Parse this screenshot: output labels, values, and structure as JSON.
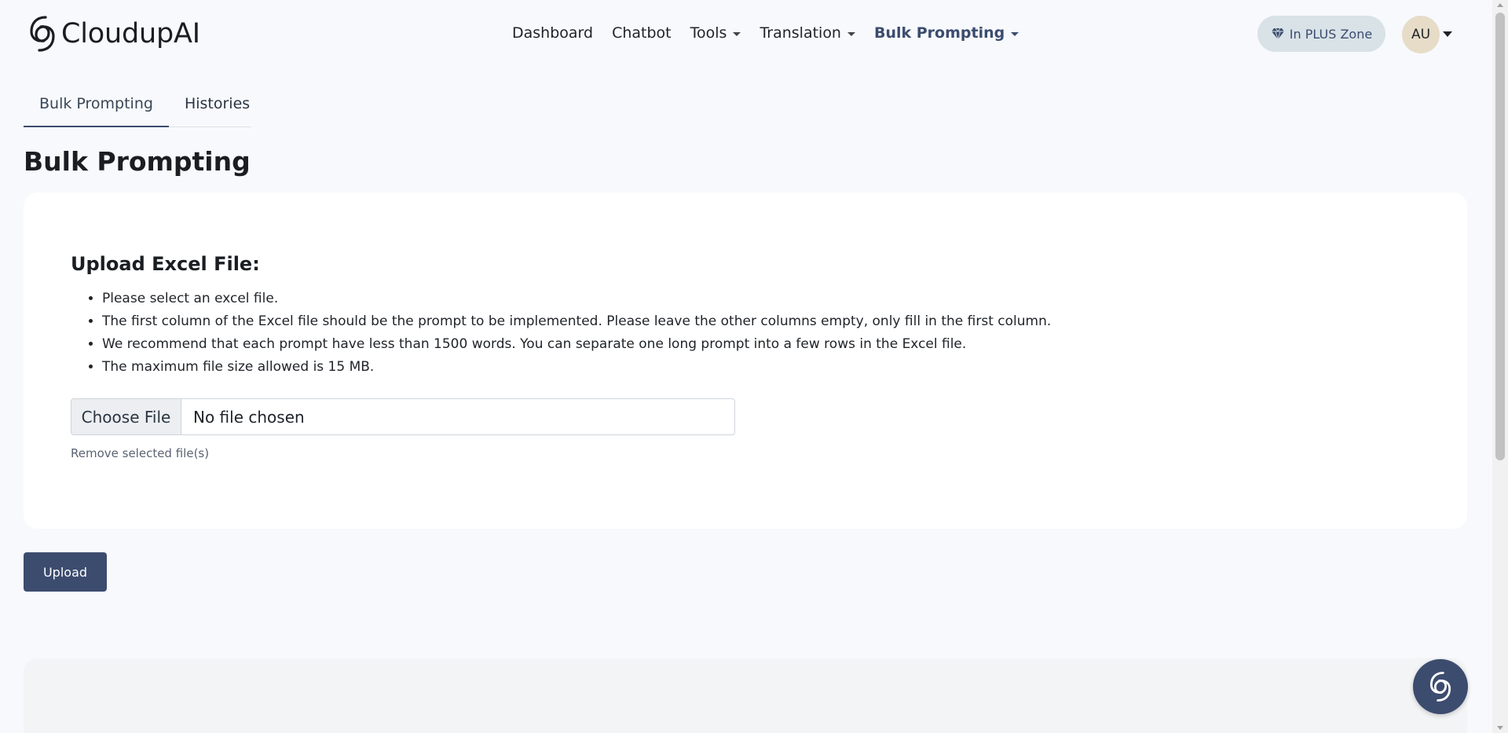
{
  "app": {
    "name": "CloudupAI"
  },
  "nav": {
    "items": [
      {
        "label": "Dashboard",
        "dropdown": false,
        "active": false
      },
      {
        "label": "Chatbot",
        "dropdown": false,
        "active": false
      },
      {
        "label": "Tools",
        "dropdown": true,
        "active": false
      },
      {
        "label": "Translation",
        "dropdown": true,
        "active": false
      },
      {
        "label": "Bulk Prompting",
        "dropdown": true,
        "active": true
      }
    ]
  },
  "header": {
    "plus_badge": {
      "label": "In PLUS Zone",
      "icon": "diamond-icon"
    },
    "avatar_initials": "AU"
  },
  "tabs": [
    {
      "label": "Bulk Prompting",
      "active": true
    },
    {
      "label": "Histories",
      "active": false
    }
  ],
  "page": {
    "title": "Bulk Prompting"
  },
  "upload_card": {
    "title": "Upload Excel File:",
    "instructions": [
      "Please select an excel file.",
      "The first column of the Excel file should be the prompt to be implemented. Please leave the other columns empty, only fill in the first column.",
      "We recommend that each prompt have less than 1500 words. You can separate one long prompt into a few rows in the Excel file.",
      "The maximum file size allowed is 15 MB."
    ],
    "file_input": {
      "button_label": "Choose File",
      "status": "No file chosen"
    },
    "remove_label": "Remove selected file(s)"
  },
  "actions": {
    "upload_label": "Upload"
  },
  "colors": {
    "primary": "#3c4c6f",
    "page_bg": "#f7f9fc",
    "card_bg": "#ffffff",
    "pill_bg": "#d8e2e7",
    "avatar_bg": "#e6dcc7"
  }
}
